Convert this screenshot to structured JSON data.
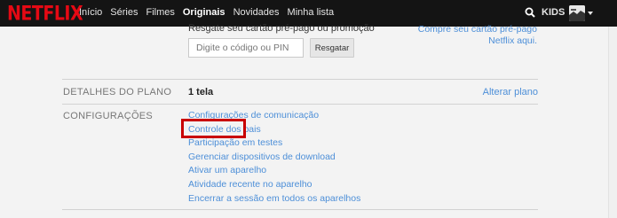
{
  "nav": {
    "logo": "NETFLIX",
    "links": [
      "Início",
      "Séries",
      "Filmes",
      "Originais",
      "Novidades",
      "Minha lista"
    ],
    "active_index": 3,
    "kids": "KIDS",
    "icons": {
      "search": "search-icon",
      "caret": "caret-down-icon",
      "avatar": "profile-avatar"
    },
    "brand_color": "#e50914"
  },
  "rescue": {
    "title": "Resgate seu cartão pré-pago ou promoção",
    "link": "Compre seu cartão pré-pago Netflix aqui.",
    "input_placeholder": "Digite o código ou PIN",
    "button": "Resgatar"
  },
  "plan": {
    "title": "DETALHES DO PLANO",
    "value": "1 tela",
    "change_link": "Alterar plano"
  },
  "settings": {
    "title": "CONFIGURAÇÕES",
    "links": [
      "Configurações de comunicação",
      "Controle dos pais",
      "Participação em testes",
      "Gerenciar dispositivos de download",
      "Ativar um aparelho",
      "Atividade recente no aparelho",
      "Encerrar a sessão em todos os aparelhos"
    ],
    "highlighted_index": 1
  },
  "colors": {
    "link": "#4d8fd8",
    "highlight": "#c90000"
  }
}
